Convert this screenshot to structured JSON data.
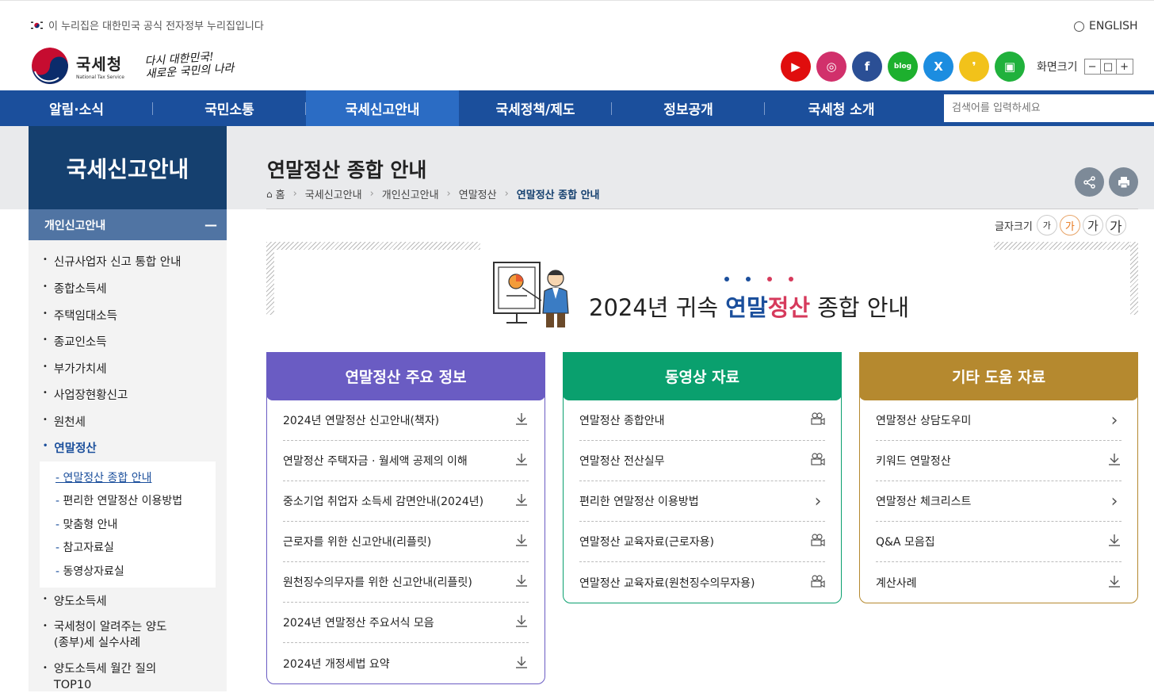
{
  "header": {
    "gov_notice": "이 누리집은 대한민국 공식 전자정부 누리집입니다",
    "english": "ENGLISH",
    "logo_ko": "국세청",
    "logo_en": "National Tax Service",
    "slogan_line1": "다시 대한민국!",
    "slogan_line2": "새로운 국민의 나라",
    "sns": [
      {
        "name": "youtube-icon",
        "glyph": "▶",
        "color": "#e00d0d"
      },
      {
        "name": "instagram-icon",
        "glyph": "◎",
        "color": "#d1306b"
      },
      {
        "name": "facebook-icon",
        "glyph": "f",
        "color": "#2b4f95"
      },
      {
        "name": "blog-icon",
        "glyph": "blog",
        "color": "#1db02e"
      },
      {
        "name": "x-icon",
        "glyph": "X",
        "color": "#1c8de0"
      },
      {
        "name": "kakao-story-icon",
        "glyph": "❜",
        "color": "#f2c21a"
      },
      {
        "name": "kakao-channel-icon",
        "glyph": "▣",
        "color": "#20b13c"
      }
    ],
    "zoom_label": "화면크기",
    "zoom_buttons": [
      "−",
      "□",
      "+"
    ]
  },
  "gnb": {
    "items": [
      "알림·소식",
      "국민소통",
      "국세신고안내",
      "국세정책/제도",
      "정보공개",
      "국세청 소개"
    ],
    "active_index": 2,
    "search_placeholder": "검색어를 입력하세요"
  },
  "sidebar": {
    "title": "국세신고안내",
    "section": "개인신고안내",
    "items": [
      "신규사업자 신고 통합 안내",
      "종합소득세",
      "주택임대소득",
      "종교인소득",
      "부가가치세",
      "사업장현황신고",
      "원천세",
      "연말정산"
    ],
    "active": "연말정산",
    "sub_items": [
      "연말정산 종합 안내",
      "편리한 연말정산 이용방법",
      "맞춤형 안내",
      "참고자료실",
      "동영상자료실"
    ],
    "items_after": [
      "양도소득세",
      "국세청이 알려주는 양도",
      "(종부)세 실수사례",
      "양도소득세 월간 질의",
      "TOP10"
    ]
  },
  "page": {
    "title": "연말정산 종합 안내",
    "breadcrumb": [
      "홈",
      "국세신고안내",
      "개인신고안내",
      "연말정산",
      "연말정산 종합 안내"
    ],
    "font_size_label": "글자크기",
    "font_sizes": [
      "가",
      "가",
      "가",
      "가"
    ]
  },
  "banner": {
    "prefix": "2024년 귀속 ",
    "highlight1": "연말",
    "highlight2": "정산",
    "suffix": " 종합 안내",
    "dot_colors": [
      "#1b4f9c",
      "#1b4f9c",
      "#d63a5c",
      "#d63a5c"
    ]
  },
  "boxes": [
    {
      "title": "연말정산 주요 정보",
      "color": "#6a5cc3",
      "rows": [
        {
          "label": "2024년 연말정산 신고안내(책자)",
          "icon": "download-icon"
        },
        {
          "label": "연말정산 주택자금 · 월세액 공제의 이해",
          "icon": "download-icon"
        },
        {
          "label": "중소기업 취업자 소득세 감면안내(2024년)",
          "icon": "download-icon"
        },
        {
          "label": "근로자를 위한 신고안내(리플릿)",
          "icon": "download-icon"
        },
        {
          "label": "원천징수의무자를 위한 신고안내(리플릿)",
          "icon": "download-icon"
        },
        {
          "label": "2024년 연말정산 주요서식 모음",
          "icon": "download-icon"
        },
        {
          "label": "2024년 개정세법 요약",
          "icon": "download-icon"
        }
      ]
    },
    {
      "title": "동영상 자료",
      "color": "#0aa06e",
      "rows": [
        {
          "label": "연말정산 종합안내",
          "icon": "video-icon"
        },
        {
          "label": "연말정산 전산실무",
          "icon": "video-icon"
        },
        {
          "label": "편리한 연말정산 이용방법",
          "icon": "chevron-right-icon"
        },
        {
          "label": "연말정산 교육자료(근로자용)",
          "icon": "video-icon"
        },
        {
          "label": "연말정산 교육자료(원천징수의무자용)",
          "icon": "video-icon"
        }
      ]
    },
    {
      "title": "기타 도움 자료",
      "color": "#b5892f",
      "rows": [
        {
          "label": "연말정산 상담도우미",
          "icon": "chevron-right-icon"
        },
        {
          "label": "키워드 연말정산",
          "icon": "download-icon"
        },
        {
          "label": "연말정산 체크리스트",
          "icon": "chevron-right-icon"
        },
        {
          "label": "Q&A 모음집",
          "icon": "download-icon"
        },
        {
          "label": "계산사례",
          "icon": "download-icon"
        }
      ]
    }
  ]
}
